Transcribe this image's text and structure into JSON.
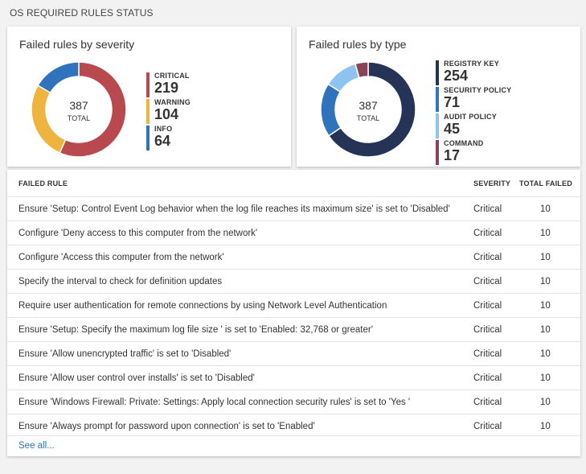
{
  "page": {
    "title": "OS REQUIRED RULES STATUS"
  },
  "severity_panel": {
    "title": "Failed rules by severity",
    "total": "387",
    "total_label": "TOTAL",
    "items": [
      {
        "label": "CRITICAL",
        "value": "219",
        "count": 219,
        "color": "#b8494e"
      },
      {
        "label": "WARNING",
        "value": "104",
        "count": 104,
        "color": "#efb43e"
      },
      {
        "label": "INFO",
        "value": "64",
        "count": 64,
        "color": "#2f73bd"
      }
    ]
  },
  "type_panel": {
    "title": "Failed rules by type",
    "total": "387",
    "total_label": "TOTAL",
    "items": [
      {
        "label": "REGISTRY KEY",
        "value": "254",
        "count": 254,
        "color": "#243356"
      },
      {
        "label": "SECURITY POLICY",
        "value": "71",
        "count": 71,
        "color": "#2f73bd"
      },
      {
        "label": "AUDIT POLICY",
        "value": "45",
        "count": 45,
        "color": "#8fc3ef"
      },
      {
        "label": "COMMAND",
        "value": "17",
        "count": 17,
        "color": "#8b4457"
      }
    ]
  },
  "table": {
    "columns": [
      "FAILED RULE",
      "SEVERITY",
      "TOTAL FAILED"
    ],
    "rows": [
      {
        "rule": "Ensure 'Setup: Control Event Log behavior when the log file reaches its maximum size' is set to 'Disabled'",
        "severity": "Critical",
        "total": "10"
      },
      {
        "rule": "Configure 'Deny access to this computer from the network'",
        "severity": "Critical",
        "total": "10"
      },
      {
        "rule": "Configure 'Access this computer from the network'",
        "severity": "Critical",
        "total": "10"
      },
      {
        "rule": "Specify the interval to check for definition updates",
        "severity": "Critical",
        "total": "10"
      },
      {
        "rule": "Require user authentication for remote connections by using Network Level Authentication",
        "severity": "Critical",
        "total": "10"
      },
      {
        "rule": "Ensure 'Setup: Specify the maximum log file size ' is set to 'Enabled: 32,768 or greater'",
        "severity": "Critical",
        "total": "10"
      },
      {
        "rule": "Ensure 'Allow unencrypted traffic' is set to 'Disabled'",
        "severity": "Critical",
        "total": "10"
      },
      {
        "rule": "Ensure 'Allow user control over installs' is set to 'Disabled'",
        "severity": "Critical",
        "total": "10"
      },
      {
        "rule": "Ensure 'Windows Firewall: Private: Settings: Apply local connection security rules' is set to 'Yes '",
        "severity": "Critical",
        "total": "10"
      },
      {
        "rule": "Ensure 'Always prompt for password upon connection' is set to 'Enabled'",
        "severity": "Critical",
        "total": "10"
      }
    ],
    "see_all": "See all..."
  }
}
